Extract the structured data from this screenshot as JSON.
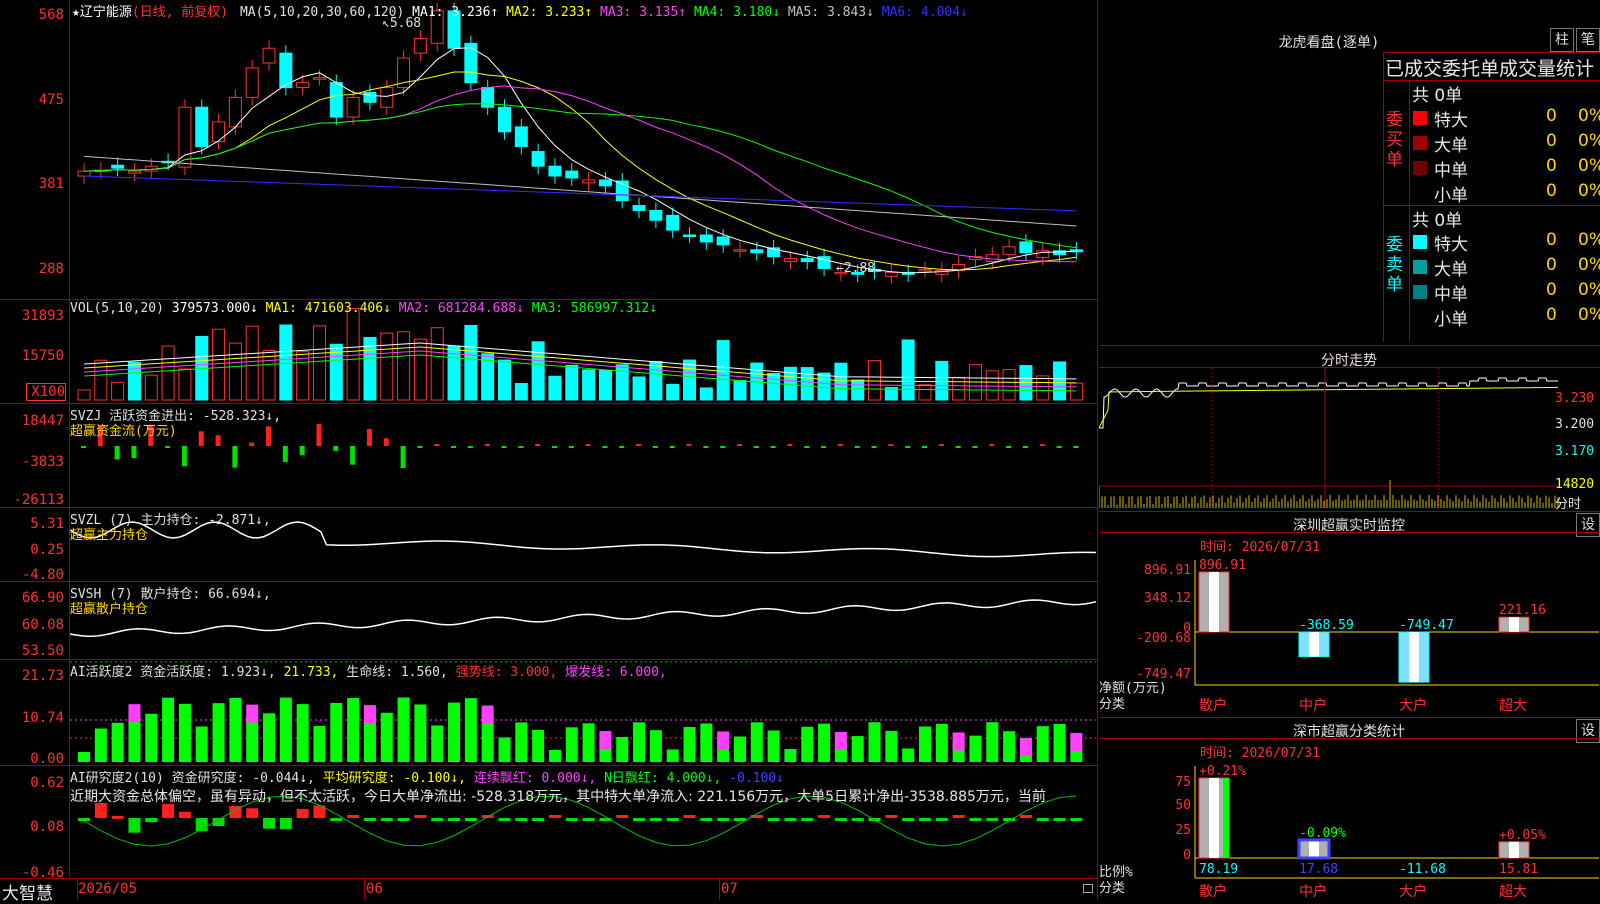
{
  "stock": {
    "name": "★辽宁能源",
    "period": "(日线, 前复权)",
    "ma_prefix": "MA(5,10,20,30,60,120)",
    "ma_values": [
      {
        "label": "MA1: 3.236↑",
        "color": "#ffffff"
      },
      {
        "label": "MA2: 3.233↑",
        "color": "#ffff00"
      },
      {
        "label": "MA3: 3.135↑",
        "color": "#ff40ff"
      },
      {
        "label": "MA4: 3.180↓",
        "color": "#00ff00"
      },
      {
        "label": "MA5: 3.843↓",
        "color": "#c0c0c0"
      },
      {
        "label": "MA6: 4.004↓",
        "color": "#3030ff"
      }
    ],
    "high_marker": "5.68",
    "low_marker": "2.88",
    "price_axis": [
      "568",
      "475",
      "381",
      "288"
    ]
  },
  "vol": {
    "label": "VOL(5,10,20)",
    "values": [
      {
        "label": "379573.000↓",
        "color": "#ffffff"
      },
      {
        "label": "MA1: 471603.406↓",
        "color": "#ffff00"
      },
      {
        "label": "MA2: 681284.688↓",
        "color": "#ff40ff"
      },
      {
        "label": "MA3: 586997.312↓",
        "color": "#00ff00"
      }
    ],
    "axis": [
      "31893",
      "15750",
      "X100"
    ]
  },
  "svzj": {
    "label": "SVZJ  活跃资金进出: -528.323↓,",
    "sub": "超赢资金流(万元)",
    "axis": [
      "18447",
      "-3833",
      "-26113"
    ]
  },
  "svzl": {
    "label": "SVZL (7) 主力持仓: -2.871↓,",
    "sub": "超赢主力持仓",
    "axis": [
      "5.31",
      "0.25",
      "-4.80"
    ]
  },
  "svsh": {
    "label": "SVSH (7) 散户持仓: 66.694↓,",
    "sub": "超赢散户持仓",
    "axis": [
      "66.90",
      "60.08",
      "53.50"
    ]
  },
  "ai_active": {
    "parts": [
      {
        "label": "AI活跃度2 资金活跃度: 1.923↓,",
        "color": "#e0e0e0"
      },
      {
        "label": "21.733,",
        "color": "#ffff00"
      },
      {
        "label": "生命线: 1.560,",
        "color": "#e0e0e0"
      },
      {
        "label": "强势线: 3.000,",
        "color": "#ff3030"
      },
      {
        "label": "爆发线: 6.000,",
        "color": "#ff40ff"
      }
    ],
    "axis": [
      "21.73",
      "10.74",
      "0.00"
    ]
  },
  "ai_research": {
    "parts": [
      {
        "label": "AI研究度2(10) 资金研究度: -0.044↓,",
        "color": "#e0e0e0"
      },
      {
        "label": "平均研究度: -0.100↓,",
        "color": "#ffff00"
      },
      {
        "label": "连续飘红: 0.000↓,",
        "color": "#ff40ff"
      },
      {
        "label": "N日飘红: 4.000↓,",
        "color": "#00ff00"
      },
      {
        "label": "-0.100↓",
        "color": "#4040ff"
      }
    ],
    "comment": "近期大资金总体偏空，虽有异动，但不太活跃，今日大单净流出: -528.318万元，其中特大单净流入: 221.156万元，大单5日累计净出-3538.885万元，当前",
    "axis": [
      "0.62",
      "0.08",
      "-0.46"
    ]
  },
  "bottom": {
    "brand": "大智慧",
    "dates": [
      "2026/05",
      "06",
      "07"
    ]
  },
  "right": {
    "lhb_title": "龙虎看盘(逐单)",
    "btn1": "柱",
    "btn2": "笔",
    "section_title": "已成交委托单成交量统计",
    "buy_label": "委买单",
    "sell_label": "委卖单",
    "buy_total": "共 0单",
    "sell_total": "共 0单",
    "buy_rows": [
      {
        "name": "特大",
        "vol": "0",
        "pct": "0%",
        "color": "#ff0000"
      },
      {
        "name": "大单",
        "vol": "0",
        "pct": "0%",
        "color": "#a00000"
      },
      {
        "name": "中单",
        "vol": "0",
        "pct": "0%",
        "color": "#700000"
      },
      {
        "name": "小单",
        "vol": "0",
        "pct": "0%",
        "color": "#000000"
      }
    ],
    "sell_rows": [
      {
        "name": "特大",
        "vol": "0",
        "pct": "0%",
        "color": "#00ffff"
      },
      {
        "name": "大单",
        "vol": "0",
        "pct": "0%",
        "color": "#00a0a0"
      },
      {
        "name": "中单",
        "vol": "0",
        "pct": "0%",
        "color": "#008080"
      },
      {
        "name": "小单",
        "vol": "0",
        "pct": "0%",
        "color": "#000000"
      }
    ],
    "fs_title": "分时走势",
    "fs_axis": [
      "3.230",
      "3.200",
      "3.170",
      "14820",
      "分时"
    ],
    "monitor_title": "深圳超赢实时监控",
    "monitor_btn": "设",
    "monitor_time": "时间: 2026/07/31",
    "monitor_axis": [
      "896.91",
      "348.12",
      "0",
      "-200.68",
      "-749.47"
    ],
    "monitor_ylabel": "净额(万元)",
    "monitor_xlabel": "分类",
    "monitor_bars": [
      {
        "name": "散户",
        "value": 896.91,
        "label": "896.91",
        "label_color": "#ff3030"
      },
      {
        "name": "中户",
        "value": -368.59,
        "label": "-368.59",
        "label_color": "#00ffff"
      },
      {
        "name": "大户",
        "value": -749.47,
        "label": "-749.47",
        "label_color": "#00ffff"
      },
      {
        "name": "超大",
        "value": 221.16,
        "label": "221.16",
        "label_color": "#ff3030"
      }
    ],
    "class_title": "深市超赢分类统计",
    "class_btn": "设",
    "class_time": "时间: 2026/07/31",
    "class_axis": [
      "75",
      "50",
      "25",
      "0"
    ],
    "class_ylabel": "比例%",
    "class_xlabel": "分类",
    "class_bars": [
      {
        "name": "散户",
        "value": 78.19,
        "pct": "+0.21%",
        "label": "78.19",
        "pct_color": "#ff3030",
        "label_color": "#00ffff"
      },
      {
        "name": "中户",
        "value": 17.68,
        "pct": "-0.09%",
        "label": "17.68",
        "pct_color": "#00ff00",
        "label_color": "#4040ff"
      },
      {
        "name": "大户",
        "value": -11.68,
        "pct": "",
        "label": "-11.68",
        "pct_color": "#00ff00",
        "label_color": "#00ffff"
      },
      {
        "name": "超大",
        "value": 15.81,
        "pct": "+0.05%",
        "label": "15.81",
        "pct_color": "#ff3030",
        "label_color": "#ff3030"
      }
    ]
  }
}
